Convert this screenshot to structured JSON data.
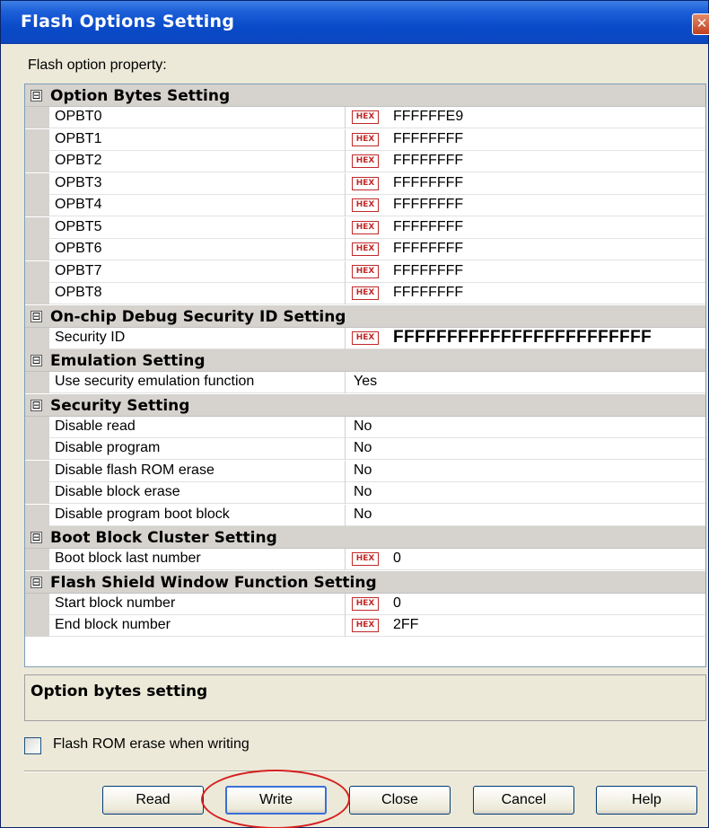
{
  "window": {
    "title": "Flash Options Setting",
    "close_glyph": "✕"
  },
  "property_label": "Flash option property:",
  "categories": [
    {
      "label": "Option Bytes Setting",
      "rows": [
        {
          "name": "OPBT0",
          "hex": true,
          "value": "FFFFFFE9"
        },
        {
          "name": "OPBT1",
          "hex": true,
          "value": "FFFFFFFF"
        },
        {
          "name": "OPBT2",
          "hex": true,
          "value": "FFFFFFFF"
        },
        {
          "name": "OPBT3",
          "hex": true,
          "value": "FFFFFFFF"
        },
        {
          "name": "OPBT4",
          "hex": true,
          "value": "FFFFFFFF"
        },
        {
          "name": "OPBT5",
          "hex": true,
          "value": "FFFFFFFF"
        },
        {
          "name": "OPBT6",
          "hex": true,
          "value": "FFFFFFFF"
        },
        {
          "name": "OPBT7",
          "hex": true,
          "value": "FFFFFFFF"
        },
        {
          "name": "OPBT8",
          "hex": true,
          "value": "FFFFFFFF"
        }
      ]
    },
    {
      "label": "On-chip Debug Security ID Setting",
      "rows": [
        {
          "name": "Security ID",
          "hex": true,
          "value": "FFFFFFFFFFFFFFFFFFFFFFFF",
          "big": true
        }
      ]
    },
    {
      "label": "Emulation Setting",
      "rows": [
        {
          "name": "Use security emulation function",
          "hex": false,
          "value": "Yes"
        }
      ]
    },
    {
      "label": "Security Setting",
      "rows": [
        {
          "name": "Disable read",
          "hex": false,
          "value": "No"
        },
        {
          "name": "Disable program",
          "hex": false,
          "value": "No"
        },
        {
          "name": "Disable flash ROM erase",
          "hex": false,
          "value": "No"
        },
        {
          "name": "Disable block erase",
          "hex": false,
          "value": "No"
        },
        {
          "name": "Disable program boot block",
          "hex": false,
          "value": "No"
        }
      ]
    },
    {
      "label": "Boot Block Cluster Setting",
      "rows": [
        {
          "name": "Boot block last number",
          "hex": true,
          "value": "0"
        }
      ]
    },
    {
      "label": "Flash Shield Window Function Setting",
      "rows": [
        {
          "name": "Start block number",
          "hex": true,
          "value": "0"
        },
        {
          "name": "End block number",
          "hex": true,
          "value": "2FF"
        }
      ]
    }
  ],
  "hex_badge": "HEX",
  "collapse_glyph": "⊟",
  "description": {
    "title": "Option bytes setting"
  },
  "erase_checkbox": {
    "label": "Flash ROM erase when writing",
    "checked": false
  },
  "buttons": {
    "read": "Read",
    "write": "Write",
    "close": "Close",
    "cancel": "Cancel",
    "help": "Help"
  },
  "colors": {
    "title_bar": "#0a4bc9",
    "highlight_ellipse": "#d42020",
    "hex_badge": "#c02828"
  }
}
